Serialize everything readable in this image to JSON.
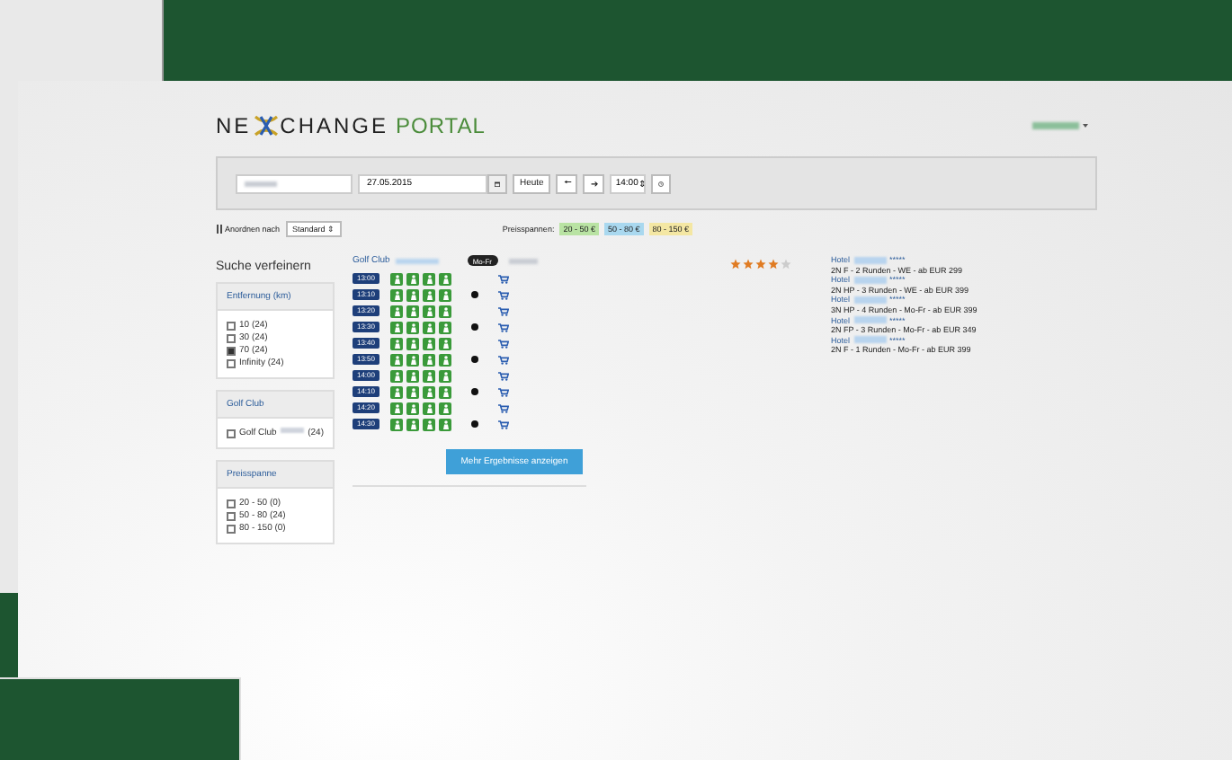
{
  "logo": {
    "brand": "NE",
    "brand_rest": "CHANGE",
    "product": "PORTAL"
  },
  "search": {
    "date": "27.05.2015",
    "today_button": "Heute",
    "prev_button": "🠔",
    "next_button": "➔",
    "time": "14:00",
    "time_caret": "⇕"
  },
  "sort": {
    "label": "Anordnen nach",
    "value": "Standard",
    "caret": "⇕"
  },
  "price_legend": {
    "label": "Preisspannen:",
    "chips": [
      {
        "label": "20 - 50 €",
        "color": "#b9e3a3"
      },
      {
        "label": "50 - 80 €",
        "color": "#a9d8ef"
      },
      {
        "label": "80 - 150 €",
        "color": "#f4e7a3"
      }
    ]
  },
  "sidebar": {
    "title": "Suche verfeinern",
    "groups": [
      {
        "title": "Entfernung (km)",
        "options": [
          {
            "label": "10 (24)",
            "checked": false
          },
          {
            "label": "30 (24)",
            "checked": false
          },
          {
            "label": "70 (24)",
            "checked": true
          },
          {
            "label": "Infinity (24)",
            "checked": false
          }
        ]
      },
      {
        "title": "Golf Club",
        "options": [
          {
            "label": "Golf Club",
            "count": "(24)",
            "checked": false
          }
        ]
      },
      {
        "title": "Preisspanne",
        "options": [
          {
            "label": "20 - 50 (0)",
            "checked": false
          },
          {
            "label": "50 - 80 (24)",
            "checked": false
          },
          {
            "label": "80 - 150 (0)",
            "checked": false
          }
        ]
      }
    ]
  },
  "club": {
    "name": "Golf Club",
    "badge": "Mo-Fr",
    "stars": 4,
    "tee_times": [
      {
        "time": "13:00",
        "marked": false
      },
      {
        "time": "13:10",
        "marked": true
      },
      {
        "time": "13:20",
        "marked": false
      },
      {
        "time": "13:30",
        "marked": true
      },
      {
        "time": "13:40",
        "marked": false
      },
      {
        "time": "13:50",
        "marked": true
      },
      {
        "time": "14:00",
        "marked": false
      },
      {
        "time": "14:10",
        "marked": true
      },
      {
        "time": "14:20",
        "marked": false
      },
      {
        "time": "14:30",
        "marked": true
      }
    ],
    "hotels": [
      {
        "name": "Hotel",
        "rating": "*****",
        "offer": "2N F - 2 Runden - WE - ab EUR 299"
      },
      {
        "name": "Hotel",
        "rating": "*****",
        "offer": "2N HP - 3 Runden - WE - ab EUR 399"
      },
      {
        "name": "Hotel",
        "rating": "*****",
        "offer": "3N HP - 4 Runden - Mo-Fr - ab EUR 399"
      },
      {
        "name": "Hotel",
        "rating": "*****",
        "offer": "2N FP - 3 Runden - Mo-Fr - ab EUR 349"
      },
      {
        "name": "Hotel",
        "rating": "*****",
        "offer": "2N F - 1 Runden - Mo-Fr - ab EUR 399"
      }
    ]
  },
  "more_button": "Mehr Ergebnisse anzeigen"
}
